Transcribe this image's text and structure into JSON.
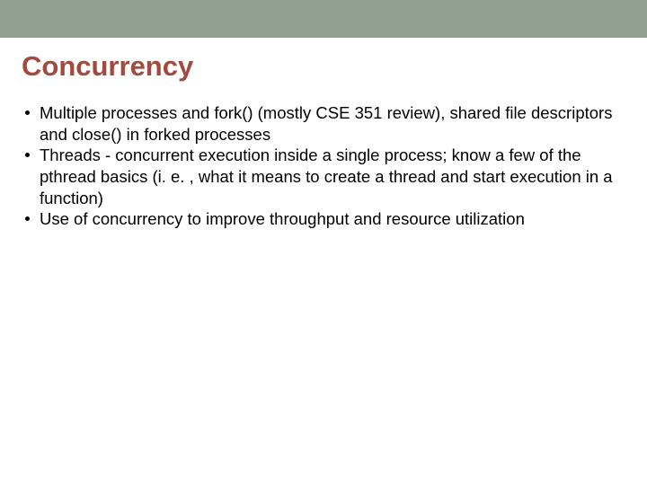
{
  "slide": {
    "title": "Concurrency",
    "bullets": [
      "Multiple processes and fork() (mostly CSE 351 review), shared file descriptors and close() in forked processes",
      "Threads - concurrent execution inside a single process; know a few of the pthread basics (i. e. , what it means to create a thread and start execution in a function)",
      "Use of concurrency to improve throughput and resource utilization"
    ]
  }
}
